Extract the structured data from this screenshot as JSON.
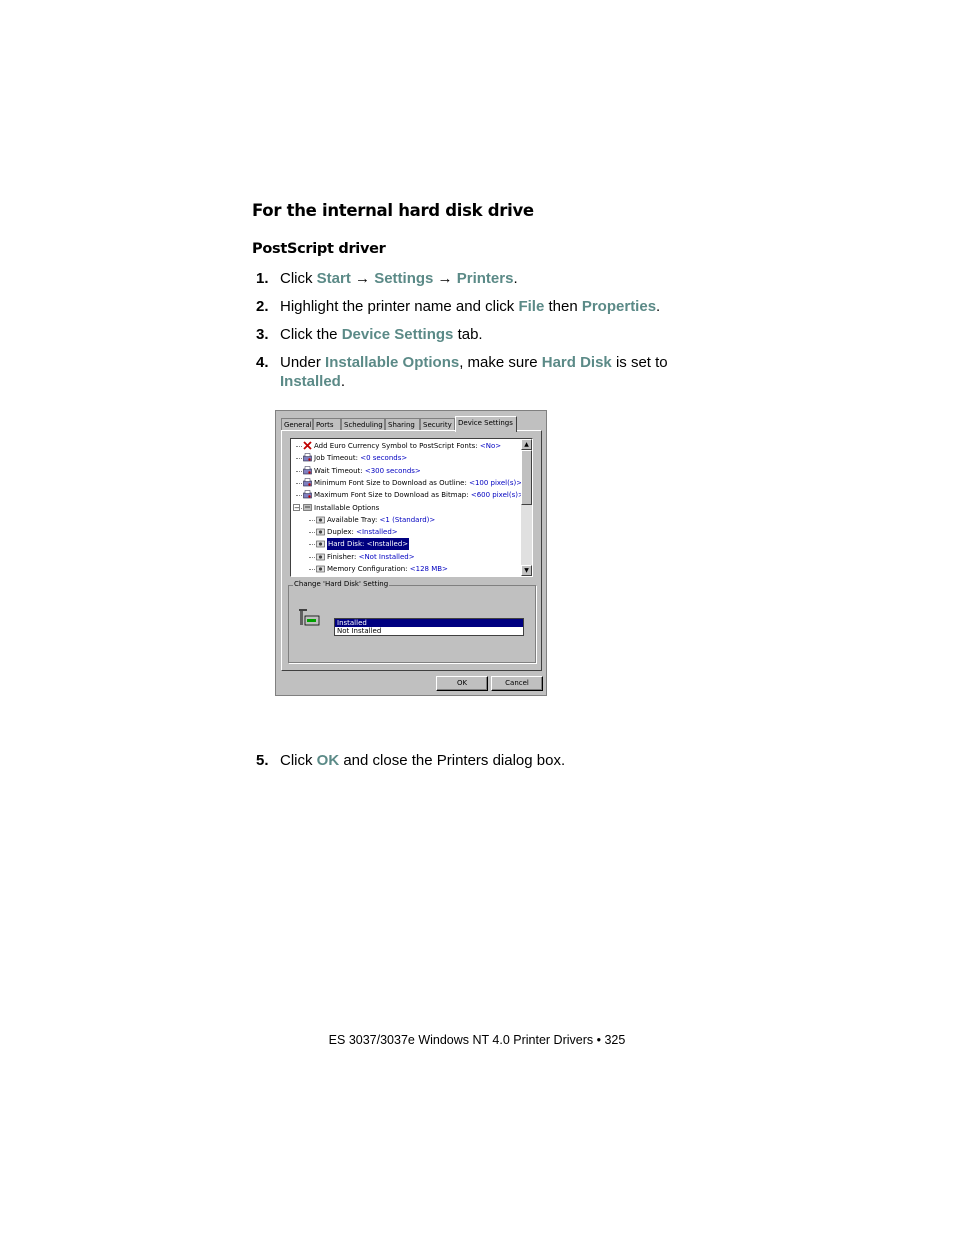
{
  "heading": "For the internal hard disk drive",
  "subheading": "PostScript driver",
  "steps": [
    {
      "num": "1.",
      "parts": [
        "Click ",
        "Start",
        " → ",
        "Settings",
        " → ",
        "Printers",
        "."
      ]
    },
    {
      "num": "2.",
      "parts": [
        "Highlight the printer name and click ",
        "File",
        " then ",
        "Properties",
        "."
      ]
    },
    {
      "num": "3.",
      "parts": [
        "Click the ",
        "Device Settings",
        " tab."
      ]
    },
    {
      "num": "4.",
      "parts": [
        "Under ",
        "Installable Options",
        ", make sure ",
        "Hard Disk",
        " is set to ",
        "Installed",
        "."
      ]
    },
    {
      "num": "5.",
      "parts": [
        "Click ",
        "OK",
        " and close the Printers dialog box."
      ]
    }
  ],
  "dialog": {
    "tabs": [
      "General",
      "Ports",
      "Scheduling",
      "Sharing",
      "Security",
      "Device Settings"
    ],
    "active_tab": "Device Settings",
    "tree": [
      {
        "label": "Add Euro Currency Symbol to PostScript Fonts: ",
        "value": "<No>",
        "icon": "red-x-icon"
      },
      {
        "label": "Job Timeout: ",
        "value": "<0 seconds>",
        "icon": "printer-settings-icon"
      },
      {
        "label": "Wait Timeout: ",
        "value": "<300 seconds>",
        "icon": "printer-settings-icon"
      },
      {
        "label": "Minimum Font Size to Download as Outline: ",
        "value": "<100 pixel(s)>",
        "icon": "printer-settings-icon"
      },
      {
        "label": "Maximum Font Size to Download as Bitmap: ",
        "value": "<600 pixel(s)>",
        "icon": "printer-settings-icon"
      },
      {
        "label": "Installable Options",
        "value": "",
        "icon": "options-folder-icon"
      },
      {
        "label": "Available Tray: ",
        "value": "<1 (Standard)>",
        "icon": "option-gear-icon"
      },
      {
        "label": "Duplex: ",
        "value": "<Installed>",
        "icon": "option-gear-icon"
      },
      {
        "label": "Hard Disk: ",
        "value": "<Installed>",
        "icon": "option-gear-icon",
        "selected": true
      },
      {
        "label": "Finisher: ",
        "value": "<Not Installed>",
        "icon": "option-gear-icon"
      },
      {
        "label": "Memory Configuration: ",
        "value": "<128 MB>",
        "icon": "option-gear-icon"
      }
    ],
    "group_title": "Change 'Hard Disk' Setting",
    "options": [
      "Installed",
      "Not Installed"
    ],
    "selected_option": "Installed",
    "ok_label": "OK",
    "cancel_label": "Cancel",
    "scroll_up": "▲",
    "scroll_down": "▼"
  },
  "footer": "ES 3037/3037e Windows NT 4.0 Printer Drivers • 325"
}
